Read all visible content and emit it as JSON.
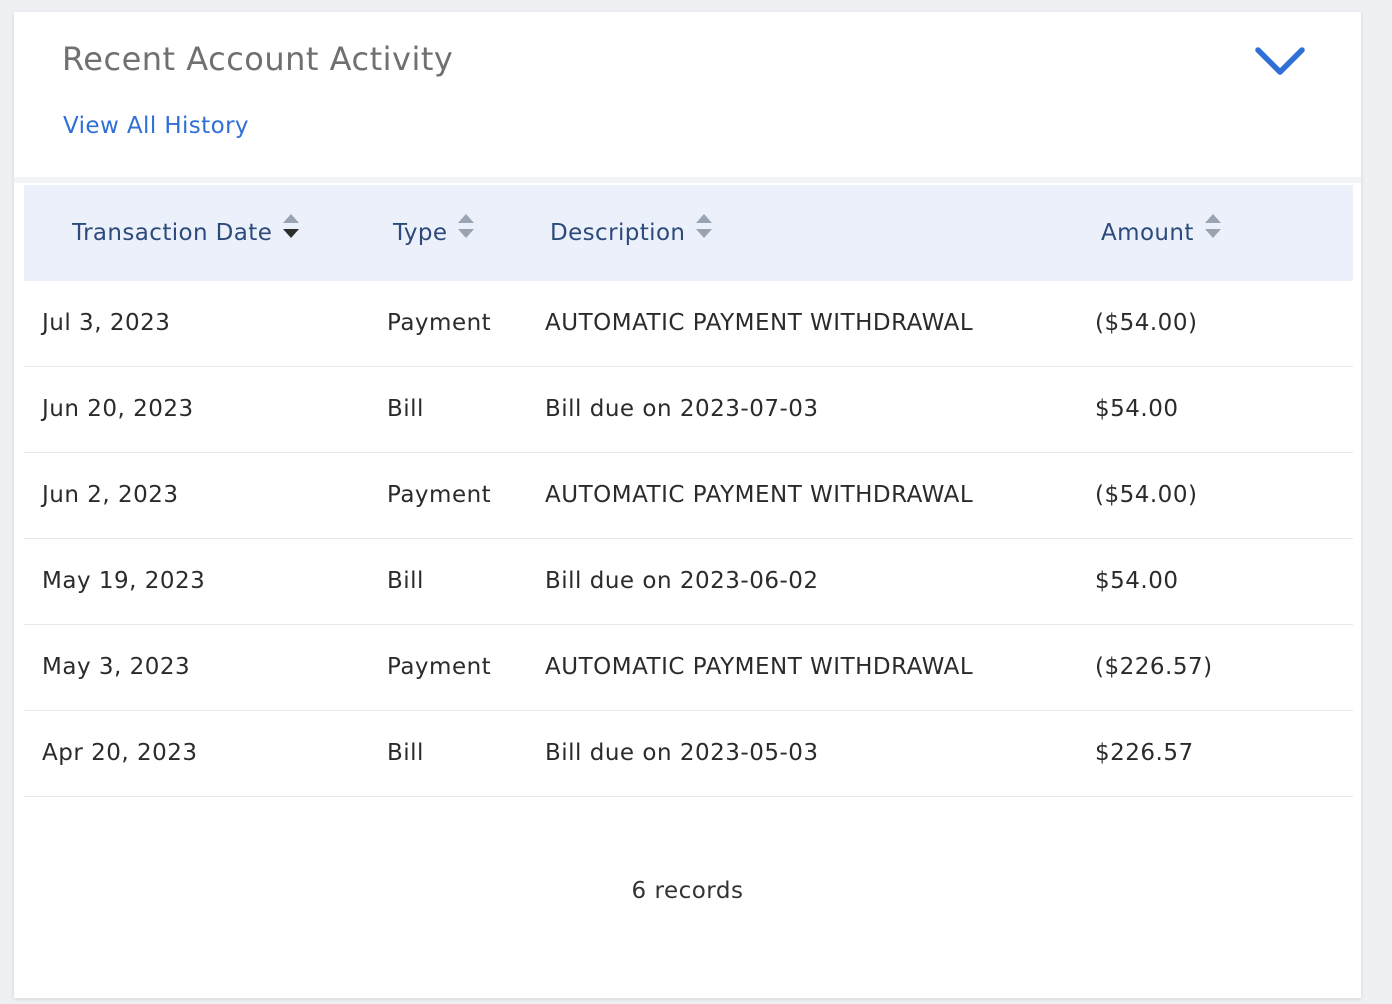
{
  "header": {
    "title": "Recent Account Activity",
    "view_all_label": "View All History",
    "collapse_icon": "chevron-down-icon"
  },
  "table": {
    "columns": [
      {
        "key": "date",
        "label": "Transaction Date",
        "sort_icon": "sort-icon"
      },
      {
        "key": "type",
        "label": "Type",
        "sort_icon": "sort-icon"
      },
      {
        "key": "description",
        "label": "Description",
        "sort_icon": "sort-icon"
      },
      {
        "key": "amount",
        "label": "Amount",
        "sort_icon": "sort-icon"
      }
    ],
    "rows": [
      {
        "date": "Jul 3, 2023",
        "type": "Payment",
        "description": "AUTOMATIC PAYMENT WITHDRAWAL",
        "amount": "($54.00)"
      },
      {
        "date": "Jun 20, 2023",
        "type": "Bill",
        "description": "Bill due on 2023-07-03",
        "amount": "$54.00"
      },
      {
        "date": "Jun 2, 2023",
        "type": "Payment",
        "description": "AUTOMATIC PAYMENT WITHDRAWAL",
        "amount": "($54.00)"
      },
      {
        "date": "May 19, 2023",
        "type": "Bill",
        "description": "Bill due on 2023-06-02",
        "amount": "$54.00"
      },
      {
        "date": "May 3, 2023",
        "type": "Payment",
        "description": "AUTOMATIC PAYMENT WITHDRAWAL",
        "amount": "($226.57)"
      },
      {
        "date": "Apr 20, 2023",
        "type": "Bill",
        "description": "Bill due on 2023-05-03",
        "amount": "$226.57"
      }
    ]
  },
  "footer": {
    "records_label": "6 records"
  },
  "colors": {
    "accent": "#2f6fd6",
    "header_row_bg": "#ebf0fb",
    "header_text": "#2c4a7a",
    "title_text": "#707070"
  }
}
